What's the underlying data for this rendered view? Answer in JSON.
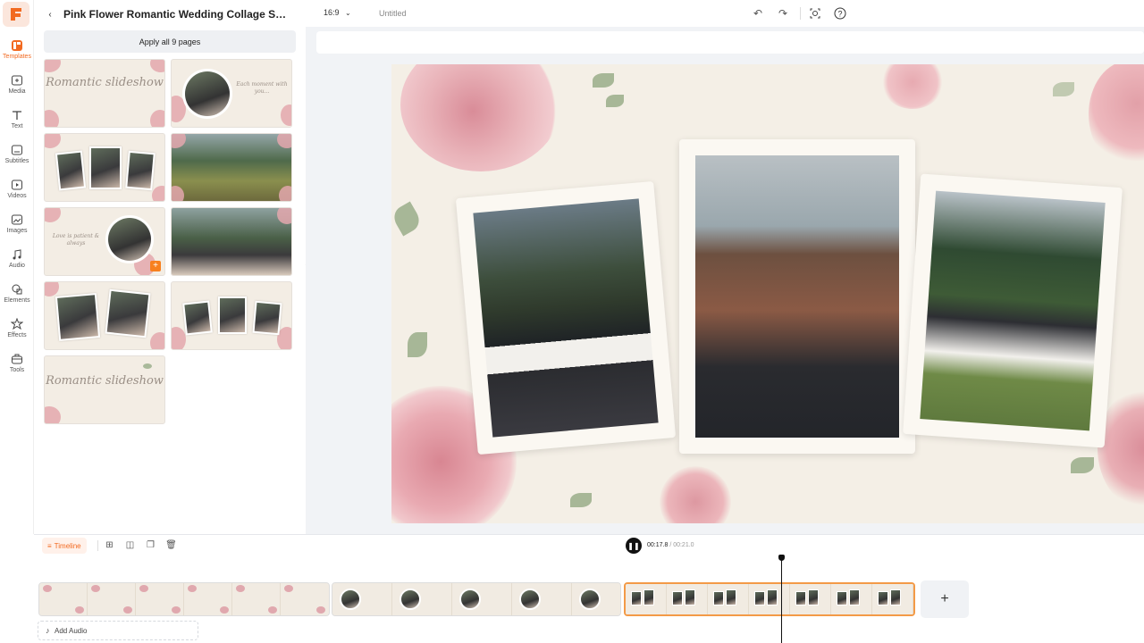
{
  "app": {
    "logo_letter": "F",
    "accent": "#f26a21"
  },
  "rail": {
    "items": [
      {
        "label": "Templates",
        "icon": "templates-icon",
        "active": true
      },
      {
        "label": "Media",
        "icon": "media-icon"
      },
      {
        "label": "Text",
        "icon": "text-icon"
      },
      {
        "label": "Subtitles",
        "icon": "subtitles-icon"
      },
      {
        "label": "Videos",
        "icon": "videos-icon"
      },
      {
        "label": "Images",
        "icon": "images-icon"
      },
      {
        "label": "Audio",
        "icon": "audio-icon"
      },
      {
        "label": "Elements",
        "icon": "elements-icon"
      },
      {
        "label": "Effects",
        "icon": "effects-icon"
      },
      {
        "label": "Tools",
        "icon": "tools-icon"
      }
    ]
  },
  "panel": {
    "title": "Pink Flower Romantic Wedding Collage Slides...",
    "apply_label": "Apply all 9 pages",
    "thumbnails": [
      {
        "name": "Romantic slideshow title",
        "text": "Romantic slideshow"
      },
      {
        "name": "Circle photo with quote",
        "text": "Each moment with you..."
      },
      {
        "name": "Three photo collage"
      },
      {
        "name": "Landscape couple photo"
      },
      {
        "name": "Our story circle",
        "text": "Love is patient & always"
      },
      {
        "name": "Couple smiling"
      },
      {
        "name": "Two tilted photos"
      },
      {
        "name": "Three small photos"
      },
      {
        "name": "Thank you slideshow",
        "text": "Romantic slideshow"
      }
    ]
  },
  "topbar": {
    "ratio": "16:9",
    "title": "Untitled"
  },
  "timeline": {
    "label": "Timeline",
    "current_time": "00:17.8",
    "total_time": "00:21.0",
    "add_audio": "Add Audio",
    "add_clip": "+"
  }
}
